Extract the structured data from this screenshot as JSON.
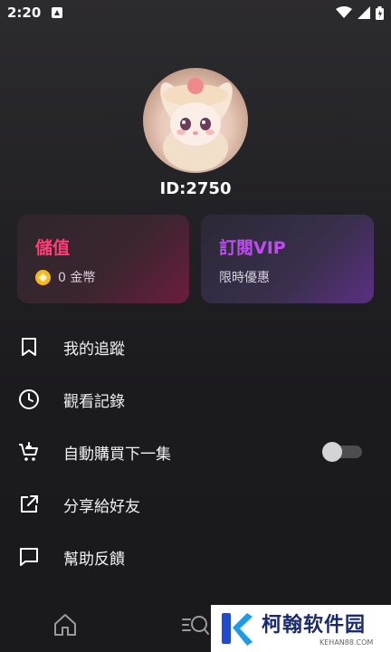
{
  "status_bar": {
    "time": "2:20"
  },
  "profile": {
    "id_label": "ID:2750"
  },
  "cards": {
    "topup": {
      "title": "儲值",
      "balance": "0 金幣"
    },
    "vip": {
      "title": "訂閱VIP",
      "subtitle": "限時優惠"
    }
  },
  "menu": {
    "items": [
      {
        "label": "我的追蹤",
        "icon": "bookmark-icon"
      },
      {
        "label": "觀看記錄",
        "icon": "clock-icon"
      },
      {
        "label": "自動購買下一集",
        "icon": "cart-icon",
        "toggle": false
      },
      {
        "label": "分享給好友",
        "icon": "share-icon"
      },
      {
        "label": "幫助反饋",
        "icon": "feedback-icon"
      }
    ]
  },
  "bottom_nav": {
    "items": [
      "home-icon",
      "search-icon"
    ]
  },
  "watermark": {
    "text": "柯翰软件园",
    "sub": "KEHAN88.COM"
  },
  "colors": {
    "topup_accent": "#ff3d77",
    "vip_accent": "#c04cf0",
    "coin": "#f5b81e"
  }
}
